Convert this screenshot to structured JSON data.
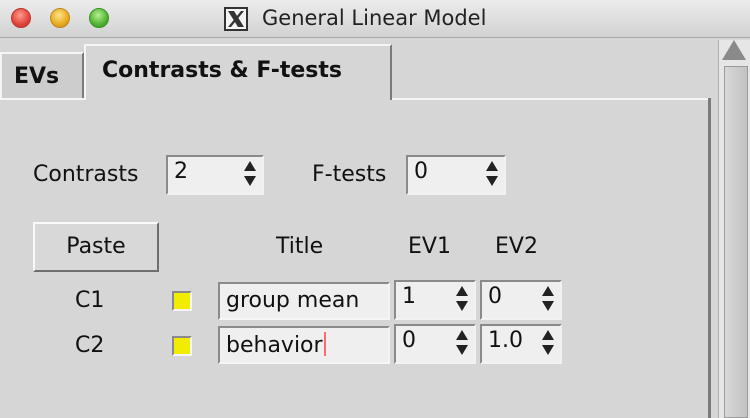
{
  "window": {
    "title": "General Linear Model"
  },
  "tabs": [
    {
      "label": "EVs"
    },
    {
      "label": "Contrasts & F-tests"
    }
  ],
  "active_tab": "Contrasts & F-tests",
  "contrasts": {
    "label": "Contrasts",
    "value": "2"
  },
  "ftests": {
    "label": "F-tests",
    "value": "0"
  },
  "paste_button": {
    "label": "Paste"
  },
  "table": {
    "headers": {
      "title": "Title",
      "ev1": "EV1",
      "ev2": "EV2"
    },
    "rows": [
      {
        "name": "C1",
        "title": "group mean",
        "ev1": "1",
        "ev2": "0",
        "color": "#f2ec00"
      },
      {
        "name": "C2",
        "title": "behavior",
        "ev1": "0",
        "ev2": "1.0",
        "color": "#f2ec00"
      }
    ]
  },
  "icons": {
    "window_icon": "x11-icon",
    "spin": "spin-arrows-icon"
  }
}
